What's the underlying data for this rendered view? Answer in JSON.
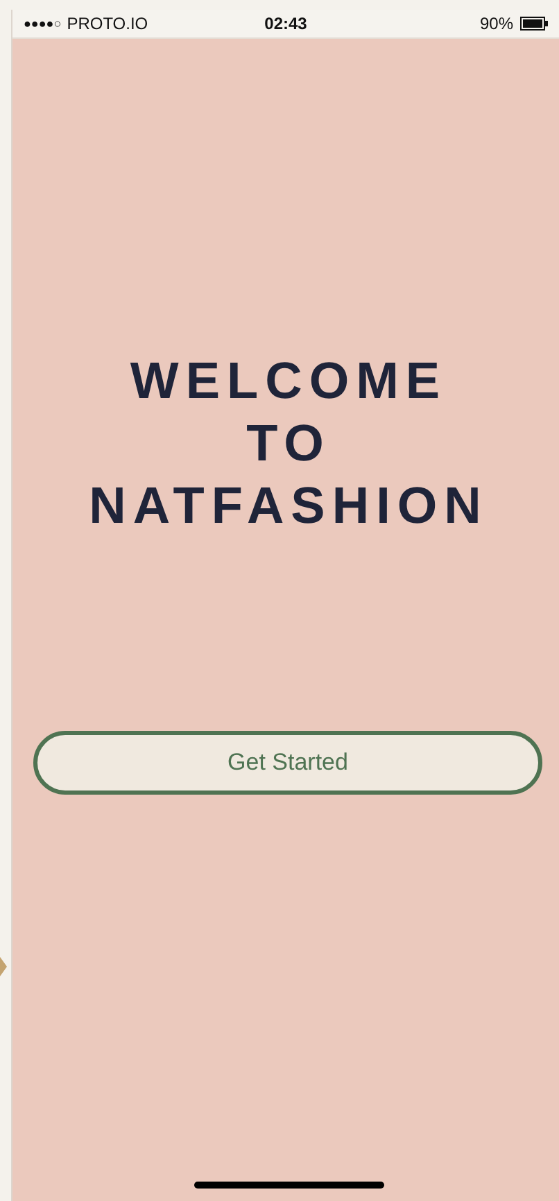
{
  "status_bar": {
    "signal": "●●●●○",
    "carrier": "PROTO.IO",
    "time": "02:43",
    "battery": "90%"
  },
  "title_lines": [
    "WELCOME",
    "TO",
    "NATFASHION"
  ],
  "button": {
    "label": "Get Started"
  }
}
